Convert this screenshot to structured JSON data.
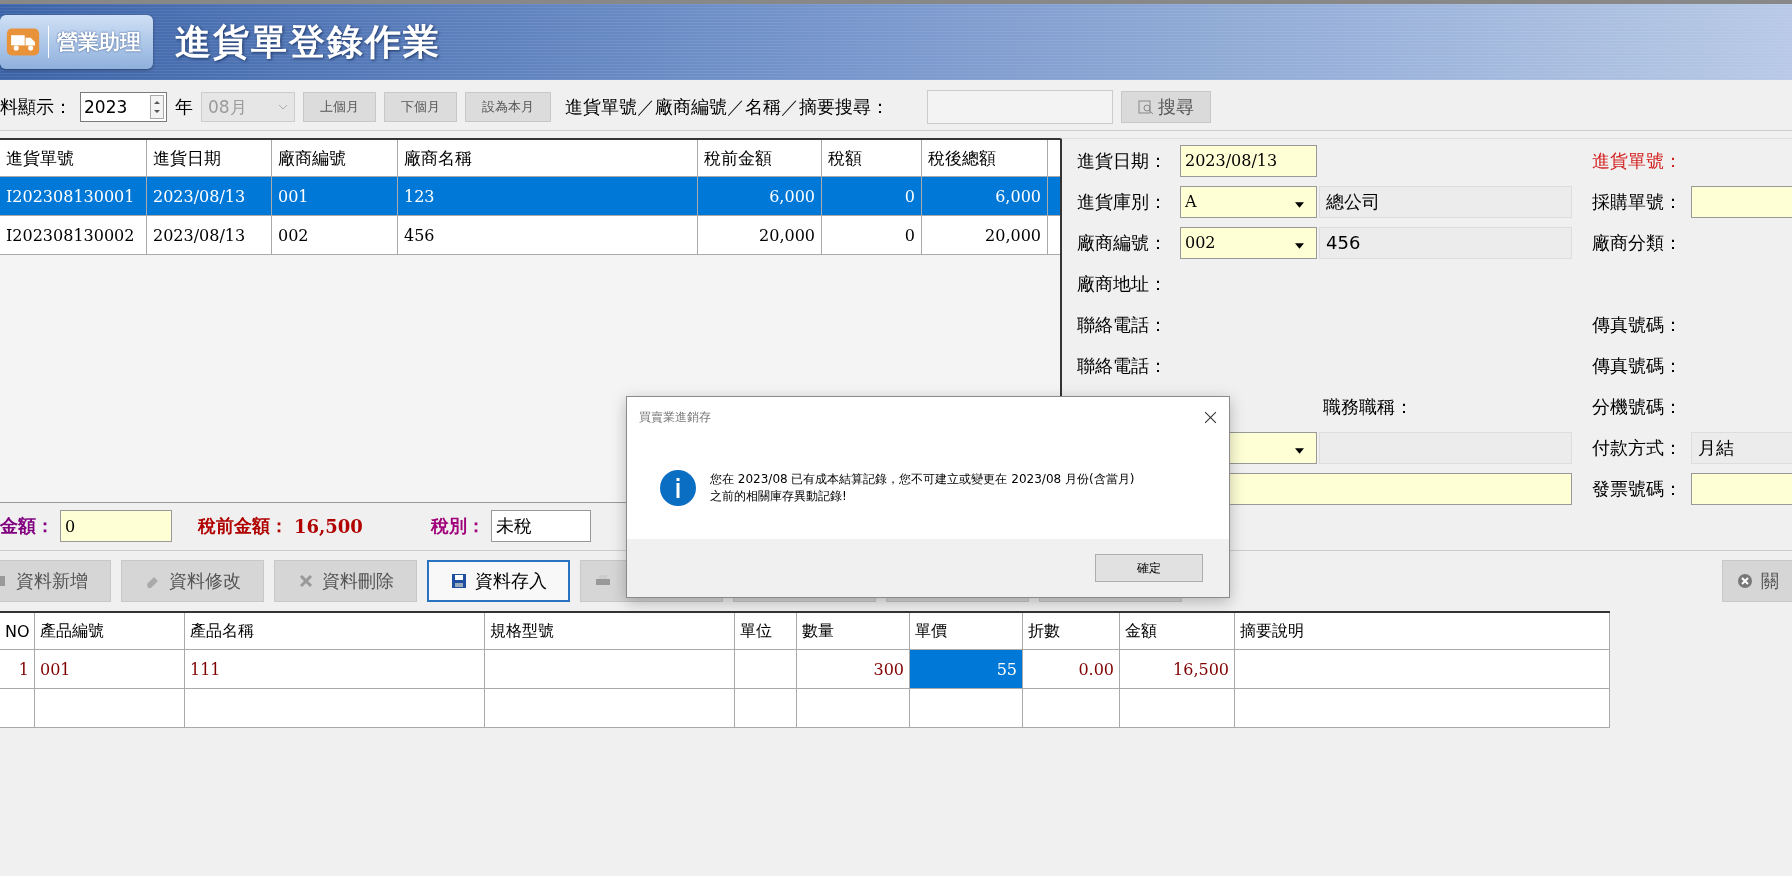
{
  "header": {
    "badge": "營業助理",
    "title": "進貨單登錄作業"
  },
  "toolbar": {
    "label": "料顯示：",
    "year": "2023",
    "year_unit": "年",
    "month": {
      "value": "08月",
      "disabled": true
    },
    "nav_buttons": [
      "上個月",
      "下個月",
      "設為本月"
    ],
    "search_label": "進貨單號／廠商編號／名稱／摘要搜尋：",
    "search_button": "搜尋"
  },
  "orders": {
    "columns": [
      {
        "label": "進貨單號",
        "kind": "text"
      },
      {
        "label": "進貨日期",
        "kind": "text"
      },
      {
        "label": "廠商編號",
        "kind": "text"
      },
      {
        "label": "廠商名稱",
        "kind": "text"
      },
      {
        "label": "稅前金額",
        "kind": "number"
      },
      {
        "label": "稅額",
        "kind": "number"
      },
      {
        "label": "稅後總額",
        "kind": "number"
      }
    ],
    "rows": [
      {
        "selected": true,
        "cells": [
          "I202308130001",
          "2023/08/13",
          "001",
          "123",
          "6,000",
          "0",
          "6,000"
        ]
      },
      {
        "selected": false,
        "cells": [
          "I202308130002",
          "2023/08/13",
          "002",
          "456",
          "20,000",
          "0",
          "20,000"
        ]
      }
    ]
  },
  "summary": {
    "discount_label": "金額：",
    "discount_value": "0",
    "pretax_label": "稅前金額：",
    "pretax_value": "16,500",
    "tax_label": "稅別：",
    "tax_value": "未稅"
  },
  "detail": {
    "rows": [
      {
        "left": {
          "label": "進貨日期：",
          "fields": [
            {
              "kind": "input",
              "value": "2023/08/13"
            }
          ]
        },
        "right": {
          "label": "進貨單號：",
          "required": true
        }
      },
      {
        "left": {
          "label": "進貨庫別：",
          "fields": [
            {
              "kind": "select",
              "value": "A"
            },
            {
              "kind": "readonly",
              "value": "總公司"
            }
          ]
        },
        "right": {
          "label": "採購單號：",
          "required": false,
          "field": {
            "kind": "input"
          }
        }
      },
      {
        "left": {
          "label": "廠商編號：",
          "fields": [
            {
              "kind": "select",
              "value": "002"
            },
            {
              "kind": "readonly",
              "value": "456"
            }
          ]
        },
        "right": {
          "label": "廠商分類：",
          "required": false
        }
      },
      {
        "left": {
          "label": "廠商地址："
        },
        "right": {}
      },
      {
        "left": {
          "label": "聯絡電話："
        },
        "right": {
          "label": "傳真號碼：",
          "required": false
        }
      },
      {
        "left": {
          "label": "聯絡電話："
        },
        "right": {
          "label": "傳真號碼：",
          "required": false
        }
      },
      {
        "left": {
          "fields": [
            {
              "kind": "blank"
            },
            {
              "kind": "label",
              "value": "職務職稱："
            }
          ]
        },
        "right": {
          "label": "分機號碼：",
          "required": false
        }
      },
      {
        "left": {
          "fields": [
            {
              "kind": "select"
            },
            {
              "kind": "readonly"
            }
          ]
        },
        "right": {
          "label": "付款方式：",
          "required": false,
          "field": {
            "kind": "readonly",
            "value": "月結"
          }
        }
      },
      {
        "left": {
          "fields": [
            {
              "kind": "wide"
            }
          ]
        },
        "right": {
          "label": "發票號碼：",
          "required": false,
          "field": {
            "kind": "input"
          }
        }
      }
    ]
  },
  "actions": [
    {
      "label": "資料新增",
      "kind": "new",
      "focused": false
    },
    {
      "label": "資料修改",
      "kind": "edit",
      "focused": false
    },
    {
      "label": "資料刪除",
      "kind": "delete",
      "focused": false
    },
    {
      "label": "資料存入",
      "kind": "save",
      "focused": true
    },
    {
      "kind": "print",
      "focused": false
    },
    {
      "focused": false
    },
    {
      "focused": false
    },
    {
      "focused": false
    }
  ],
  "close_button": "關",
  "items": {
    "columns": [
      {
        "label": "NO",
        "kind": "number"
      },
      {
        "label": "產品編號",
        "kind": "text"
      },
      {
        "label": "產品名稱",
        "kind": "text"
      },
      {
        "label": "規格型號",
        "kind": "text"
      },
      {
        "label": "單位",
        "kind": "text"
      },
      {
        "label": "數量",
        "kind": "number"
      },
      {
        "label": "單價",
        "kind": "number"
      },
      {
        "label": "折數",
        "kind": "number"
      },
      {
        "label": "金額",
        "kind": "number"
      },
      {
        "label": "摘要說明",
        "kind": "text"
      }
    ],
    "rows": [
      {
        "cells": [
          {
            "text": "1",
            "selected": false
          },
          {
            "text": "001",
            "selected": false
          },
          {
            "text": "111",
            "selected": false
          },
          {
            "selected": false
          },
          {
            "selected": false
          },
          {
            "text": "300",
            "selected": false
          },
          {
            "text": "55",
            "selected": true
          },
          {
            "text": "0.00",
            "selected": false
          },
          {
            "text": "16,500",
            "selected": false
          },
          {
            "selected": false
          }
        ]
      }
    ]
  },
  "dialog": {
    "title": "買賣業進銷存",
    "message": "您在 2023/08 已有成本結算記錄，您不可建立或變更在 2023/08 月份(含當月)之前的相關庫存異動記錄!",
    "button": "確定"
  }
}
